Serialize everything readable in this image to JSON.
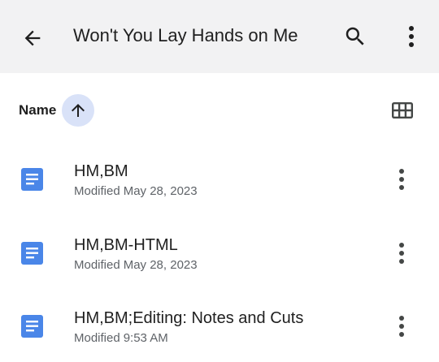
{
  "app_bar": {
    "title": "Won't You Lay Hands on Me",
    "back_icon": "arrow-back-icon",
    "search_icon": "search-icon",
    "more_icon": "more-vertical-icon"
  },
  "sort_bar": {
    "label": "Name",
    "direction": "ascending",
    "direction_icon": "arrow-up-icon",
    "view_toggle_icon": "grid-view-icon"
  },
  "files": [
    {
      "name": "HM,BM",
      "modified_label": "Modified",
      "modified_value": "May 28, 2023",
      "icon": "google-docs-icon"
    },
    {
      "name": "HM,BM-HTML",
      "modified_label": "Modified",
      "modified_value": "May 28, 2023",
      "icon": "google-docs-icon"
    },
    {
      "name": "HM,BM;Editing: Notes and Cuts",
      "modified_label": "Modified",
      "modified_value": "9:53 AM",
      "icon": "google-docs-icon"
    }
  ],
  "colors": {
    "app_bar_bg": "#f2f2f3",
    "sort_chip_bg": "#d9e2f8",
    "docs_blue": "#4a86e8",
    "icon_dark": "#444746",
    "secondary_text": "#5f6368"
  }
}
